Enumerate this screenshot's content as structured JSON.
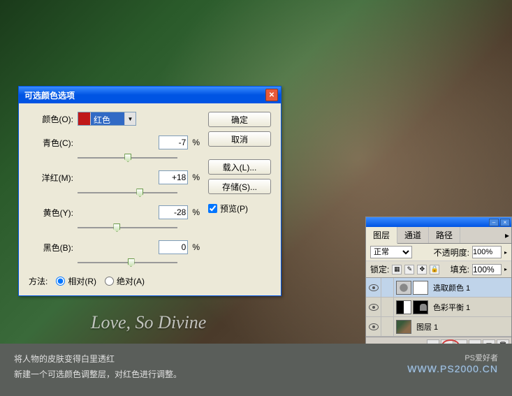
{
  "bg": {
    "title_text": "Love, So Divine"
  },
  "caption": {
    "line1": "将人物的皮肤变得白里透红",
    "line2": "新建一个可选颜色调整层，对红色进行调整。",
    "brand": "PS爱好者",
    "url": "WWW.PS2000.CN"
  },
  "dialog": {
    "title": "可选颜色选项",
    "color_label": "颜色(O):",
    "color_name": "红色",
    "sliders": [
      {
        "label": "青色(C):",
        "value": "-7",
        "pos": 47
      },
      {
        "label": "洋红(M):",
        "value": "+18",
        "pos": 59
      },
      {
        "label": "黄色(Y):",
        "value": "-28",
        "pos": 36
      },
      {
        "label": "黑色(B):",
        "value": "0",
        "pos": 50
      }
    ],
    "method_label": "方法:",
    "radio_rel": "相对(R)",
    "radio_abs": "绝对(A)",
    "buttons": {
      "ok": "确定",
      "cancel": "取消",
      "load": "载入(L)...",
      "save": "存储(S)..."
    },
    "preview": "预览(P)",
    "percent": "%"
  },
  "panel": {
    "tabs": {
      "layers": "图层",
      "channels": "通道",
      "paths": "路径"
    },
    "blend_mode": "正常",
    "opacity_label": "不透明度:",
    "opacity_value": "100%",
    "lock_label": "锁定:",
    "fill_label": "填充:",
    "fill_value": "100%",
    "layers": [
      {
        "name": "选取颜色 1"
      },
      {
        "name": "色彩平衡 1"
      },
      {
        "name": "图层 1"
      }
    ]
  }
}
